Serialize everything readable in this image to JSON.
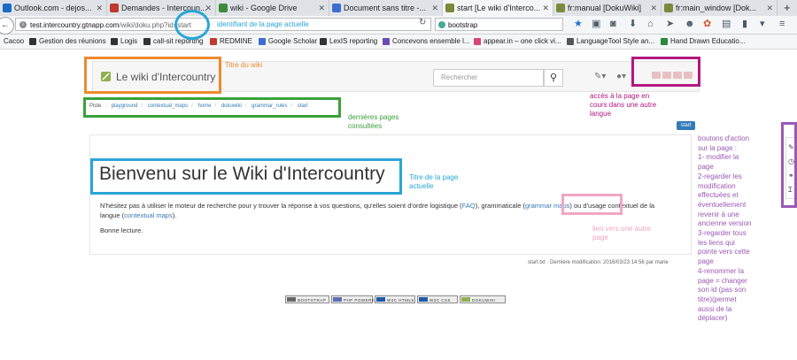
{
  "browser": {
    "tabs": [
      {
        "title": "Outlook.com - dejos...",
        "color": "#1b6bc7"
      },
      {
        "title": "Demandes - Intercoun...",
        "color": "#c0392b"
      },
      {
        "title": "wiki - Google Drive",
        "color": "#3c8c3c"
      },
      {
        "title": "Document sans titre -...",
        "color": "#3a6fd0"
      },
      {
        "title": "start [Le wiki d'Interco...",
        "color": "#7a8a3a"
      },
      {
        "title": "fr:manual [DokuWiki]",
        "color": "#7a8a3a"
      },
      {
        "title": "fr:main_window [Dok...",
        "color": "#7a8a3a"
      }
    ],
    "new_tab": "+",
    "url_host": "test.intercountry.gtnapp.com",
    "url_path": "/wiki/doku.php?id=start",
    "search_value": "bootstrap",
    "bookmarks": [
      "Cacoo",
      "Gestion des réunions",
      "Logis",
      "call-sit reporting",
      "REDMINE",
      "Google Scholar",
      "LexIS reporting",
      "Concevons ensemble l...",
      "appear.in – one click vi...",
      "LanguageTool Style an...",
      "Hand Drawn Educatio..."
    ]
  },
  "wiki": {
    "title": "Le wiki d'Intercountry",
    "search_placeholder": "Rechercher",
    "breadcrumb": [
      "Piste",
      "playground",
      "contextual_maps",
      "home",
      "dokuwiki",
      "grammar_rules",
      "start"
    ],
    "start_badge": "start",
    "page_title": "Bienvenu sur le Wiki d'Intercountry",
    "para_1": "N'hésitez pas à utiliser le moteur de recherche pour y trouver la réponse à vos questions, qu'elles soient d'ordre logistique (",
    "link_faq": "FAQ",
    "para_2": "), grammaticale (",
    "link_grammar": "grammar maps",
    "para_3": ") ou d'usage contextuel de la langue (",
    "link_contextual": "contextual maps",
    "para_4": ").",
    "signoff": "Bonne lecture.",
    "page_info": "start.txt · Dernière modification: 2016/03/23 14:56 par marie",
    "footer_badges": [
      "BOOTSTRAP",
      "PHP POWERED",
      "W3C HTML5",
      "W3C CSS",
      "DOKUWIKI"
    ]
  },
  "annotations": {
    "page_id": "identifiant de la page actuelle",
    "wiki_title": "Titre du wiki",
    "lang_access": "accès à la page en\ncours dans une autre\nlangue",
    "recent_pages": "dernières pages\nconsultées",
    "page_title": "Titre de la page\nactuelle",
    "link_other": "lien vers une autre\npage",
    "actions": "boutons d'action\nsur la page :\n1- modifier la\npage\n2-regarder les\nmodification\neffectuées et\néventuellement\nrevenir à une\nancienne version\n3-regarder tous\nles liens qui\npointe vers cette\npage\n4-renommer la\npage = changer\nson id (pas son\ntitre)(permet\naussi de la\ndéplacer)"
  },
  "colors": {
    "orange": "#ed8a2e",
    "blue": "#29a6d8",
    "green": "#3aa13a",
    "magenta": "#b3177f",
    "pink": "#f2a6c4",
    "purple": "#9b59b6",
    "link": "#337ab7"
  }
}
